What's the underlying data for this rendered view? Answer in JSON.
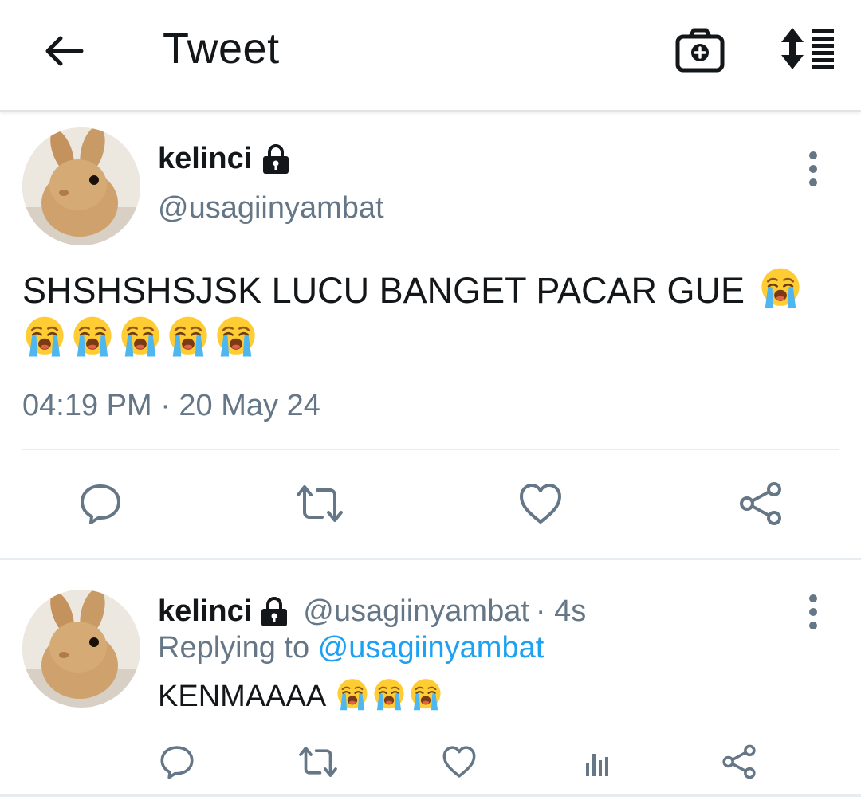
{
  "header": {
    "title": "Tweet",
    "back_icon": "arrow-left-icon",
    "camera_icon": "camera-plus-icon",
    "sort_icon": "sort-list-icon"
  },
  "tweet": {
    "display_name": "kelinci",
    "handle": "@usagiinyambat",
    "text": "SHSHSHSJSK LUCU BANGET PACAR GUE",
    "emoji_count": 6,
    "emoji": "loudly-crying-face",
    "timestamp": "04:19 PM · 20 May 24",
    "actions": [
      "reply-icon",
      "retweet-icon",
      "like-icon",
      "share-icon"
    ]
  },
  "reply": {
    "display_name": "kelinci",
    "handle": "@usagiinyambat",
    "time": "· 4s",
    "replying_prefix": "Replying to ",
    "replying_to": "@usagiinyambat",
    "text": "KENMAAAA",
    "emoji_count": 3,
    "actions": [
      "reply-icon",
      "retweet-icon",
      "like-icon",
      "analytics-icon",
      "share-icon"
    ]
  },
  "colors": {
    "text": "#14171a",
    "secondary": "#657786",
    "link": "#1da1f2",
    "divider": "#e6ecf0"
  }
}
